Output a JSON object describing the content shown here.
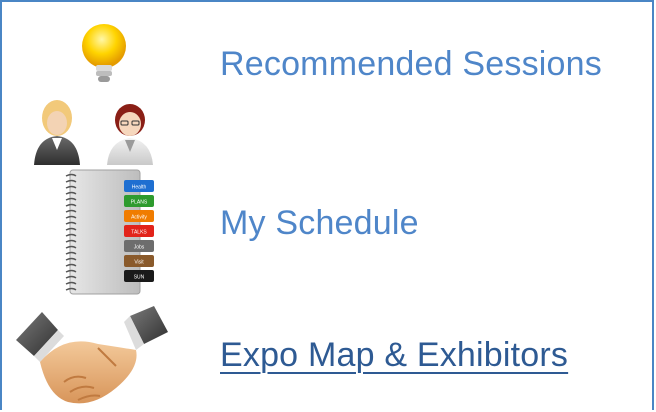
{
  "links": [
    {
      "label": "Recommended Sessions",
      "icon": "recommendation-lightbulb-people-icon"
    },
    {
      "label": "My Schedule",
      "icon": "schedule-notebook-icon"
    },
    {
      "label": "Expo Map & Exhibitors",
      "icon": "handshake-icon"
    }
  ],
  "notebook_tabs": [
    "Health",
    "PLANS",
    "Activity",
    "TALKS",
    "Jobs",
    "Visit",
    "SUN"
  ],
  "colors": {
    "link": "#4f86c9",
    "link_visited": "#2e5a93",
    "frame_border": "#4a86c5"
  }
}
